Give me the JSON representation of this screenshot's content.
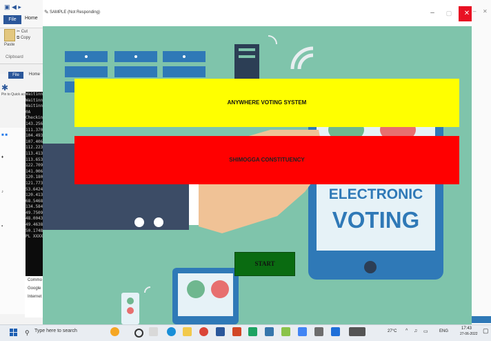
{
  "background_window": {
    "file_tab": "File",
    "home_tab": "Home",
    "clipboard": {
      "cut": "Cut",
      "copy": "Copy",
      "paste": "Paste",
      "group": "Clipboard"
    },
    "pin_label": "Pin to Quick access",
    "console_lines": [
      "Waitinng",
      "",
      "Waitinng",
      "",
      "Waitinng",
      "0A",
      "Checkin",
      "143.256",
      "111.370",
      "104.493",
      "107.406",
      "112.223",
      "113.413",
      "113.653",
      "122.709",
      "141.006",
      "120.180",
      "121.773",
      "53.6424",
      "120.413",
      "68.5468",
      "134.584",
      "49.7509",
      "48.0043",
      "49.4638",
      "50.1748",
      "PL XXXX"
    ],
    "folder_items": [
      "Commo",
      "Google",
      "Internet"
    ]
  },
  "app_window": {
    "title": "SAMPLE (Not Responding)",
    "banner_title": "ANYWHERE VOTING SYSTEM",
    "constituency": "SHIMOGGA CONSTITUENCY",
    "start_label": "START",
    "illustration_text": [
      "ELECTRONIC",
      "VOTING"
    ]
  },
  "colors": {
    "banner1": "#ffff00",
    "banner2": "#ff0000",
    "start": "#0a6b11",
    "canvas": "#7fc4ab",
    "close": "#e81123"
  },
  "taskbar": {
    "search_placeholder": "Type here to search",
    "temperature": "27°C",
    "language": "ENG",
    "time": "17:43",
    "date": "27-06-2022"
  },
  "icons": [
    "windows-start-icon",
    "search-icon",
    "task-view-icon",
    "edge-icon",
    "file-explorer-icon",
    "chrome-icon",
    "word-icon",
    "powerpoint-icon",
    "excel-icon",
    "python-icon",
    "notepad-icon",
    "photos-icon",
    "app-icon",
    "weather-icon",
    "chevron-up-icon",
    "network-icon",
    "volume-icon",
    "battery-icon",
    "notification-icon"
  ]
}
